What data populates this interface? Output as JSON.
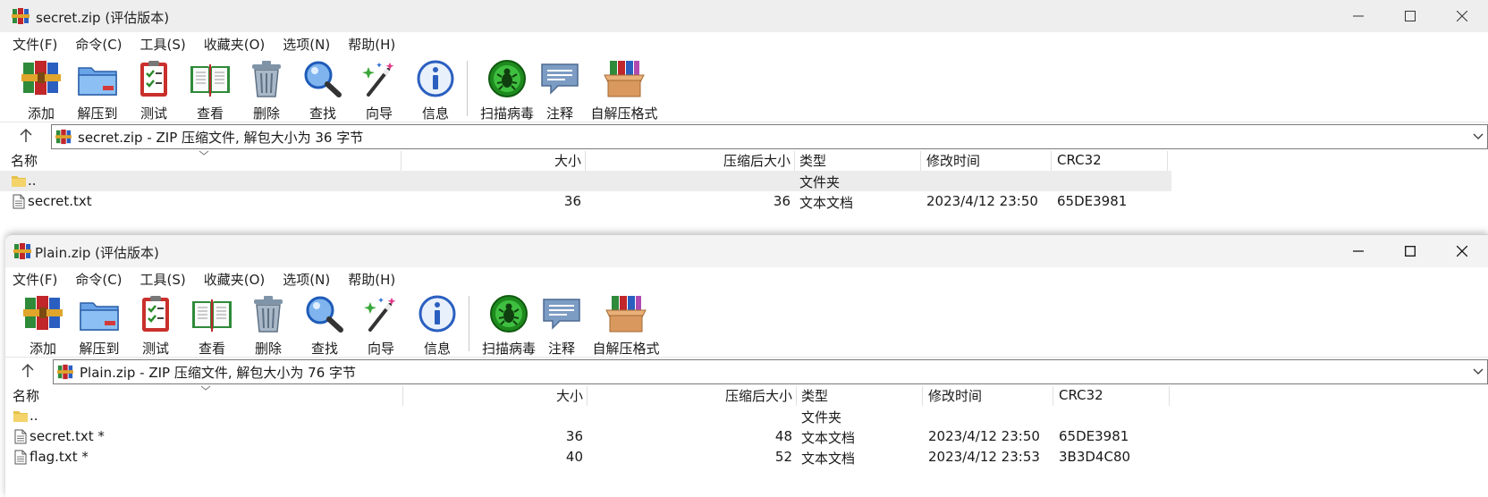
{
  "window1": {
    "title": "secret.zip (评估版本)",
    "address": "secret.zip - ZIP 压缩文件, 解包大小为 36 字节",
    "rows": [
      {
        "name": "..",
        "size": "",
        "packed": "",
        "type": "文件夹",
        "modified": "",
        "crc": "",
        "icon": "folder-icon"
      },
      {
        "name": "secret.txt",
        "size": "36",
        "packed": "36",
        "type": "文本文档",
        "modified": "2023/4/12 23:50",
        "crc": "65DE3981",
        "icon": "text-file-icon"
      }
    ]
  },
  "window2": {
    "title": "Plain.zip (评估版本)",
    "address": "Plain.zip - ZIP 压缩文件, 解包大小为 76 字节",
    "rows": [
      {
        "name": "..",
        "size": "",
        "packed": "",
        "type": "文件夹",
        "modified": "",
        "crc": "",
        "icon": "folder-icon"
      },
      {
        "name": "secret.txt *",
        "size": "36",
        "packed": "48",
        "type": "文本文档",
        "modified": "2023/4/12 23:50",
        "crc": "65DE3981",
        "icon": "text-file-icon"
      },
      {
        "name": "flag.txt *",
        "size": "40",
        "packed": "52",
        "type": "文本文档",
        "modified": "2023/4/12 23:53",
        "crc": "3B3D4C80",
        "icon": "text-file-icon"
      }
    ]
  },
  "menu": [
    "文件(F)",
    "命令(C)",
    "工具(S)",
    "收藏夹(O)",
    "选项(N)",
    "帮助(H)"
  ],
  "toolbar": [
    {
      "label": "添加",
      "icon": "add-archive-icon"
    },
    {
      "label": "解压到",
      "icon": "extract-to-icon"
    },
    {
      "label": "测试",
      "icon": "test-clipboard-icon"
    },
    {
      "label": "查看",
      "icon": "view-book-icon"
    },
    {
      "label": "删除",
      "icon": "trash-can-icon"
    },
    {
      "label": "查找",
      "icon": "magnifier-icon"
    },
    {
      "label": "向导",
      "icon": "wizard-wand-icon"
    },
    {
      "label": "信息",
      "icon": "info-icon"
    },
    {
      "label": "扫描病毒",
      "icon": "virus-scan-icon"
    },
    {
      "label": "注释",
      "icon": "comment-icon"
    },
    {
      "label": "自解压格式",
      "icon": "sfx-box-icon"
    }
  ],
  "columns": {
    "name": "名称",
    "size": "大小",
    "packed": "压缩后大小",
    "type": "类型",
    "modified": "修改时间",
    "crc": "CRC32"
  },
  "colors": {
    "titlebar": "#eeeeee",
    "selected_row": "#ececec",
    "accent_blue": "#1f6fd6"
  }
}
